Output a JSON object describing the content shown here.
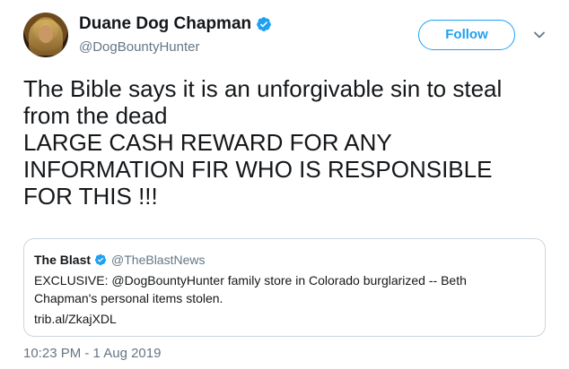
{
  "author": {
    "display_name": "Duane Dog Chapman",
    "handle": "@DogBountyHunter",
    "verified": true,
    "avatar_icon": "profile-photo"
  },
  "actions": {
    "follow_label": "Follow",
    "more_icon": "chevron-down-icon"
  },
  "tweet": {
    "lines": [
      "The Bible says it is an unforgivable sin to steal",
      "from the dead",
      "LARGE CASH REWARD FOR ANY",
      "INFORMATION FIR WHO IS RESPONSIBLE",
      "FOR THIS !!!"
    ],
    "timestamp": "10:23 PM - 1 Aug 2019"
  },
  "quoted_tweet": {
    "display_name": "The Blast",
    "handle": "@TheBlastNews",
    "verified": true,
    "body_lines": [
      "EXCLUSIVE: @DogBountyHunter family store in Colorado burglarized -- Beth",
      "Chapman's personal items stolen."
    ],
    "link": "trib.al/ZkajXDL"
  },
  "colors": {
    "accent": "#1da1f2",
    "text": "#14171a",
    "secondary_text": "#657786",
    "border": "#ccd6dd"
  }
}
